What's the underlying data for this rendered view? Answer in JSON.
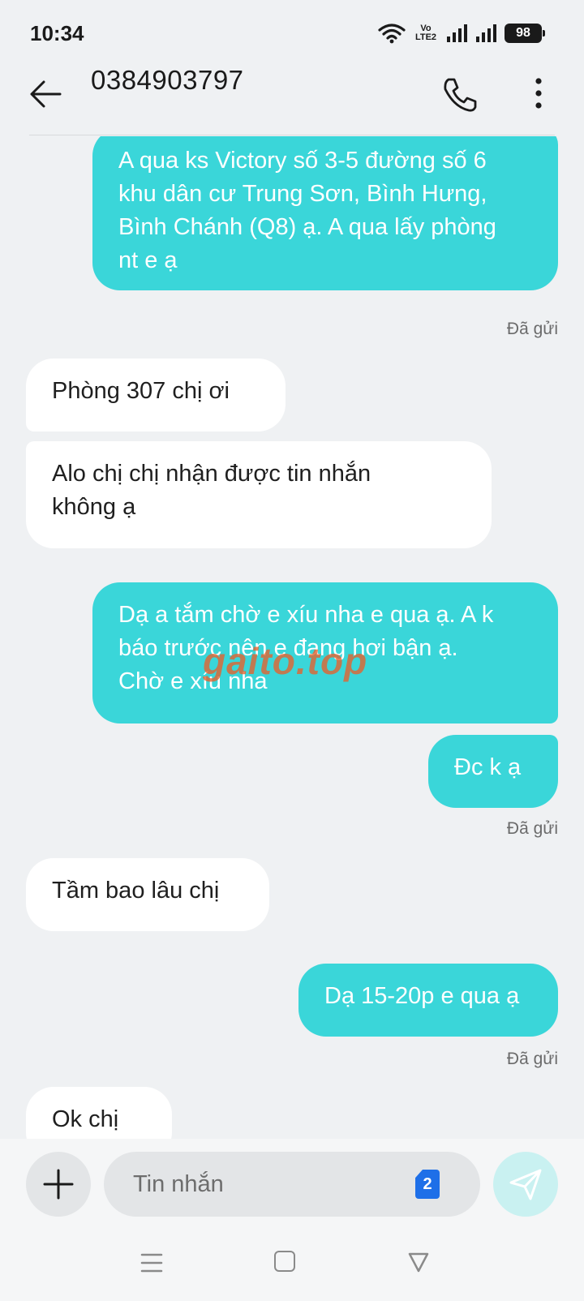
{
  "status_bar": {
    "time": "10:34",
    "volte_line1": "Vo",
    "volte_line2": "LTE2",
    "battery": "98",
    "icons": [
      "wifi-icon",
      "volte-icon",
      "signal-icon",
      "signal-icon",
      "battery-icon"
    ]
  },
  "header": {
    "title": "0384903797",
    "icons": [
      "back-arrow-icon",
      "phone-icon",
      "more-vertical-icon"
    ]
  },
  "messages": [
    {
      "direction": "out",
      "text": "A qua ks Victory số 3-5 đường số 6\nkhu dân cư Trung Sơn, Bình Hưng,\nBình Chánh (Q8) ạ. A qua lấy phòng\nnt e ạ"
    },
    {
      "direction": "out",
      "status": "Đã gửi"
    },
    {
      "direction": "in",
      "text": "Phòng 307 chị ơi"
    },
    {
      "direction": "in",
      "text": "Alo chị chị nhận được tin nhắn\nkhông ạ"
    },
    {
      "direction": "out",
      "text": "Dạ a tắm chờ e xíu nha e qua ạ. A k\nbáo trước nên e đang hơi bận ạ.\nChờ e xíu nha"
    },
    {
      "direction": "out",
      "text": "Đc k ạ"
    },
    {
      "direction": "out",
      "status": "Đã gửi"
    },
    {
      "direction": "in",
      "text": "Tầm bao lâu chị"
    },
    {
      "direction": "out",
      "text": "Dạ 15-20p e qua ạ"
    },
    {
      "direction": "out",
      "status": "Đã gửi"
    },
    {
      "direction": "in",
      "text": "Ok chị"
    }
  ],
  "watermark": "gaito.top",
  "composer": {
    "placeholder": "Tin nhắn",
    "sim_badge": "2",
    "icons": [
      "plus-icon",
      "send-icon"
    ]
  },
  "colors": {
    "outgoing_bubble": "#3ad6d9",
    "incoming_bubble": "#ffffff",
    "background": "#eff1f3",
    "sim_badge": "#1e6fe8",
    "send_button_disabled": "#c9f1f1"
  },
  "nav_bar": {
    "icons": [
      "menu-icon",
      "home-square-icon",
      "back-triangle-icon"
    ]
  }
}
